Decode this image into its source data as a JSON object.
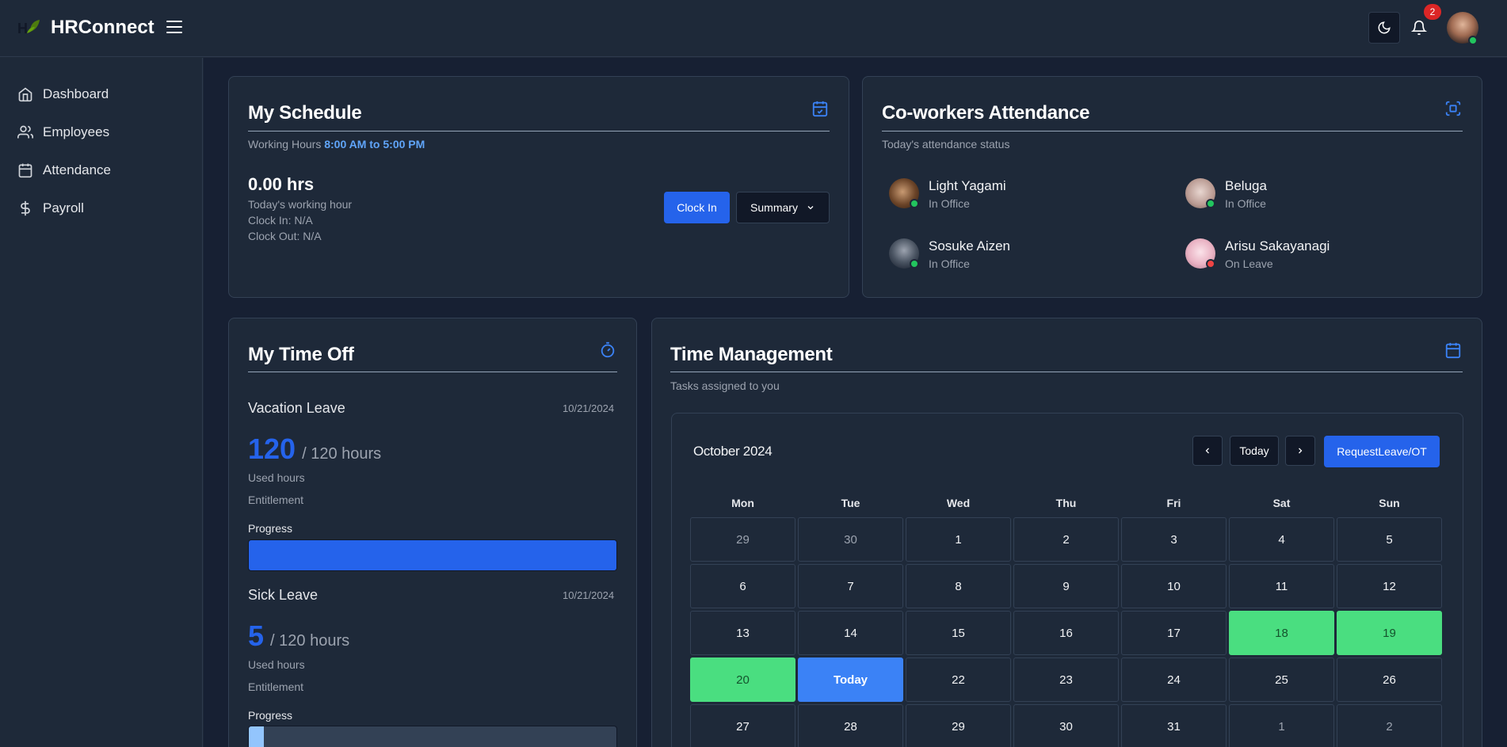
{
  "app": {
    "brand": "HRConnect",
    "notification_count": "2"
  },
  "sidebar": {
    "items": [
      {
        "label": "Dashboard",
        "icon": "home-icon"
      },
      {
        "label": "Employees",
        "icon": "users-icon"
      },
      {
        "label": "Attendance",
        "icon": "calendar-icon"
      },
      {
        "label": "Payroll",
        "icon": "dollar-icon"
      }
    ]
  },
  "schedule": {
    "title": "My Schedule",
    "working_hours_label": "Working Hours",
    "working_hours_value": "8:00 AM to 5:00 PM",
    "hours": "0.00 hrs",
    "hours_caption": "Today's working hour",
    "clock_in": "Clock In: N/A",
    "clock_out": "Clock Out: N/A",
    "clock_in_button": "Clock In",
    "summary_button": "Summary"
  },
  "coworkers": {
    "title": "Co-workers Attendance",
    "subtitle": "Today's attendance status",
    "people": [
      {
        "name": "Light Yagami",
        "status": "In Office"
      },
      {
        "name": "Beluga",
        "status": "In Office"
      },
      {
        "name": "Sosuke Aizen",
        "status": "In Office"
      },
      {
        "name": "Arisu Sakayanagi",
        "status": "On Leave"
      }
    ]
  },
  "timeoff": {
    "title": "My Time Off",
    "leaves": [
      {
        "type": "Vacation Leave",
        "date": "10/21/2024",
        "used": "120",
        "total": "/ 120 hours",
        "used_label": "Used hours",
        "entitlement_label": "Entitlement",
        "progress_label": "Progress",
        "progress_fraction": 1.0
      },
      {
        "type": "Sick Leave",
        "date": "10/21/2024",
        "used": "5",
        "total": "/ 120 hours",
        "used_label": "Used hours",
        "entitlement_label": "Entitlement",
        "progress_label": "Progress",
        "progress_fraction": 0.042
      }
    ]
  },
  "time_mgmt": {
    "title": "Time Management",
    "subtitle": "Tasks assigned to you",
    "month": "October 2024",
    "today_button": "Today",
    "request_button": "RequestLeave/OT",
    "days": [
      "Mon",
      "Tue",
      "Wed",
      "Thu",
      "Fri",
      "Sat",
      "Sun"
    ],
    "cells": [
      {
        "label": "29",
        "state": "muted"
      },
      {
        "label": "30",
        "state": "muted"
      },
      {
        "label": "1",
        "state": ""
      },
      {
        "label": "2",
        "state": ""
      },
      {
        "label": "3",
        "state": ""
      },
      {
        "label": "4",
        "state": ""
      },
      {
        "label": "5",
        "state": ""
      },
      {
        "label": "6",
        "state": ""
      },
      {
        "label": "7",
        "state": ""
      },
      {
        "label": "8",
        "state": ""
      },
      {
        "label": "9",
        "state": ""
      },
      {
        "label": "10",
        "state": ""
      },
      {
        "label": "11",
        "state": ""
      },
      {
        "label": "12",
        "state": ""
      },
      {
        "label": "13",
        "state": ""
      },
      {
        "label": "14",
        "state": ""
      },
      {
        "label": "15",
        "state": ""
      },
      {
        "label": "16",
        "state": ""
      },
      {
        "label": "17",
        "state": ""
      },
      {
        "label": "18",
        "state": "green"
      },
      {
        "label": "19",
        "state": "green"
      },
      {
        "label": "20",
        "state": "green"
      },
      {
        "label": "Today",
        "state": "today"
      },
      {
        "label": "22",
        "state": ""
      },
      {
        "label": "23",
        "state": ""
      },
      {
        "label": "24",
        "state": ""
      },
      {
        "label": "25",
        "state": ""
      },
      {
        "label": "26",
        "state": ""
      },
      {
        "label": "27",
        "state": ""
      },
      {
        "label": "28",
        "state": ""
      },
      {
        "label": "29",
        "state": ""
      },
      {
        "label": "30",
        "state": ""
      },
      {
        "label": "31",
        "state": ""
      },
      {
        "label": "1",
        "state": "muted"
      },
      {
        "label": "2",
        "state": "muted"
      }
    ]
  },
  "colors": {
    "accent": "#2563eb",
    "highlight": "#4ade80",
    "online": "#22c55e",
    "leave": "#ef4444"
  }
}
